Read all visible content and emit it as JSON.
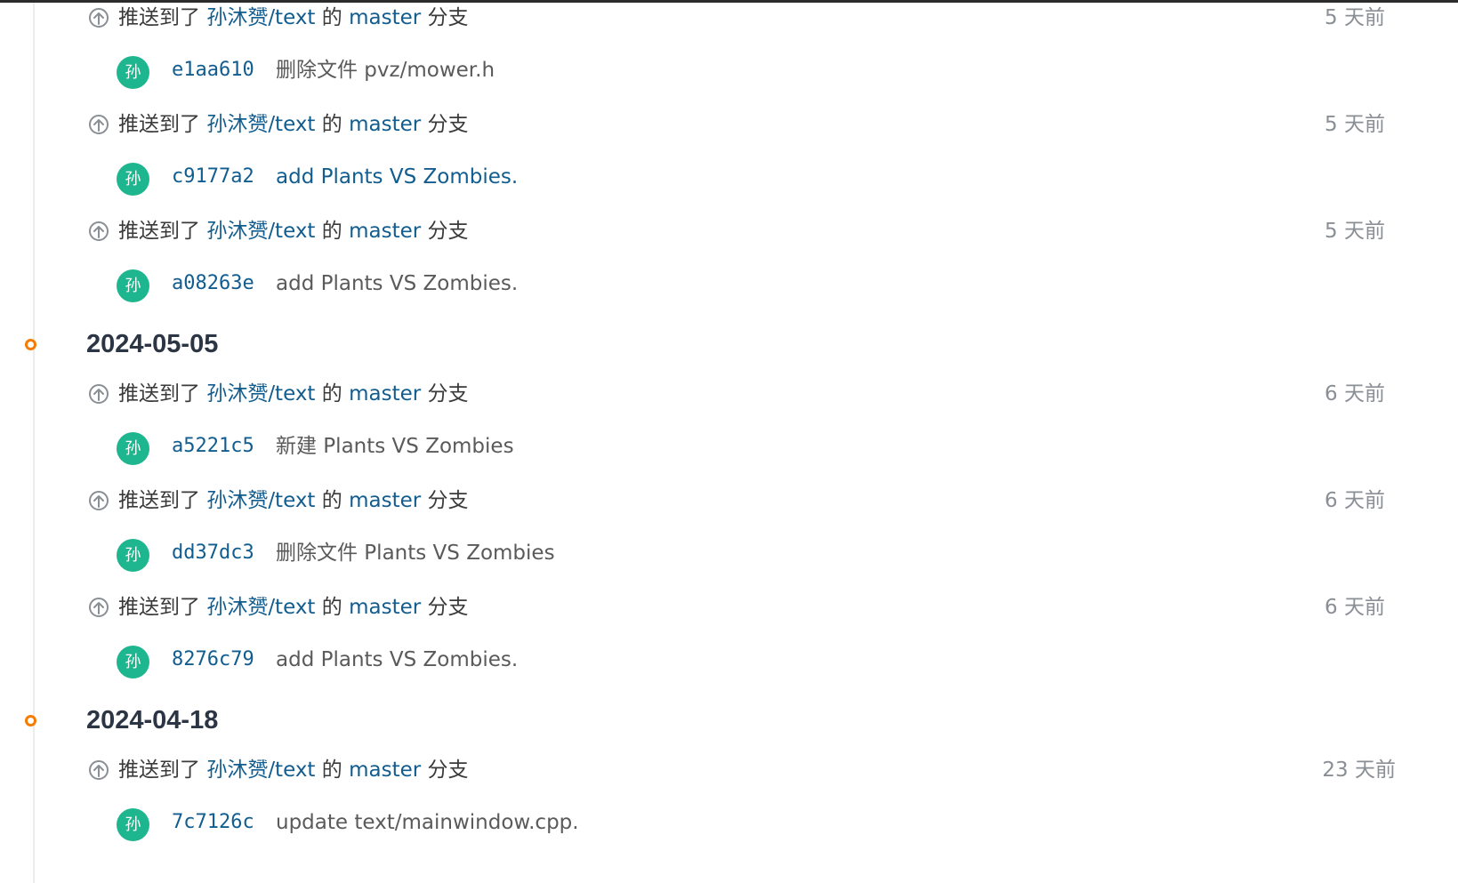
{
  "avatar_char": "孙",
  "push_parts": {
    "prefix": "推送到了 ",
    "repo": "孙沐赟/text",
    "middle": " 的 ",
    "branch": "master",
    "suffix": " 分支"
  },
  "groups": [
    {
      "date": "",
      "items": [
        {
          "time": "5 天前",
          "sha": "e1aa610",
          "message": "删除文件 pvz/mower.h",
          "message_is_link": false
        },
        {
          "time": "5 天前",
          "sha": "c9177a2",
          "message": "add Plants VS Zombies.",
          "message_is_link": true
        },
        {
          "time": "5 天前",
          "sha": "a08263e",
          "message": "add Plants VS Zombies.",
          "message_is_link": false
        }
      ]
    },
    {
      "date": "2024-05-05",
      "items": [
        {
          "time": "6 天前",
          "sha": "a5221c5",
          "message": "新建 Plants VS Zombies",
          "message_is_link": false
        },
        {
          "time": "6 天前",
          "sha": "dd37dc3",
          "message": "删除文件 Plants VS Zombies",
          "message_is_link": false
        },
        {
          "time": "6 天前",
          "sha": "8276c79",
          "message": "add Plants VS Zombies.",
          "message_is_link": false
        }
      ]
    },
    {
      "date": "2024-04-18",
      "items": [
        {
          "time": "23 天前",
          "sha": "7c7126c",
          "message": "update text/mainwindow.cpp.",
          "message_is_link": false
        }
      ]
    }
  ],
  "colors": {
    "link": "#125d8f",
    "avatar_bg": "#1eb68f",
    "date_dot": "#f57c00",
    "muted": "#8a8f96"
  },
  "icons": {
    "push": "arrow-up-circle-icon",
    "date_marker": "timeline-dot-icon"
  }
}
